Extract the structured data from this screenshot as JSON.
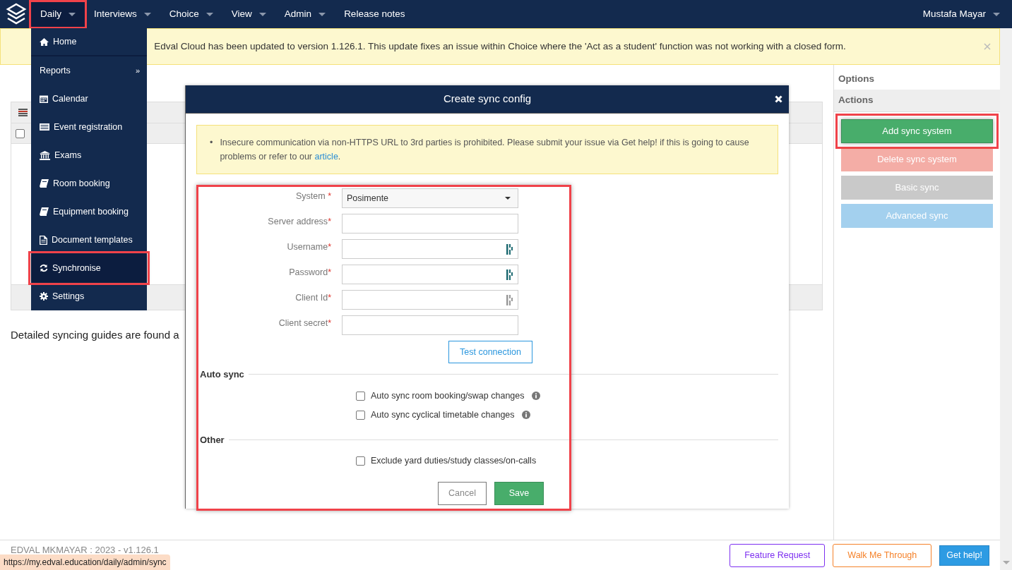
{
  "navbar": {
    "items": [
      {
        "label": "Daily",
        "caret": true,
        "selected": true,
        "highlighted": true
      },
      {
        "label": "Interviews",
        "caret": true,
        "selected": false,
        "highlighted": false
      },
      {
        "label": "Choice",
        "caret": true,
        "selected": false,
        "highlighted": false
      },
      {
        "label": "View",
        "caret": true,
        "selected": false,
        "highlighted": false
      },
      {
        "label": "Admin",
        "caret": true,
        "selected": false,
        "highlighted": false
      },
      {
        "label": "Release notes",
        "caret": false,
        "selected": false,
        "highlighted": false
      }
    ],
    "user": "Mustafa Mayar"
  },
  "banner": {
    "text": "Edval Cloud has been updated to version 1.126.1.  This update fixes an issue within Choice where the 'Act as a student' function was not working with a closed form."
  },
  "daily_menu": {
    "items": [
      {
        "label": "Home",
        "kind": "home",
        "submenu": false,
        "selected": false,
        "highlighted": false
      },
      {
        "label": "Reports",
        "kind": "none",
        "submenu": true,
        "submenu_mark": "»",
        "selected": false,
        "highlighted": false
      },
      {
        "label": "Calendar",
        "kind": "calendar",
        "submenu": false,
        "selected": false,
        "highlighted": false
      },
      {
        "label": "Event registration",
        "kind": "list",
        "submenu": false,
        "selected": false,
        "highlighted": false
      },
      {
        "label": "Exams",
        "kind": "bank",
        "submenu": false,
        "selected": false,
        "highlighted": false
      },
      {
        "label": "Room booking",
        "kind": "book",
        "submenu": false,
        "selected": false,
        "highlighted": false
      },
      {
        "label": "Equipment booking",
        "kind": "book",
        "submenu": false,
        "selected": false,
        "highlighted": false
      },
      {
        "label": "Document templates",
        "kind": "file",
        "submenu": false,
        "selected": false,
        "highlighted": false
      },
      {
        "label": "Synchronise",
        "kind": "sync",
        "submenu": false,
        "selected": true,
        "highlighted": true
      },
      {
        "label": "Settings",
        "kind": "gear",
        "submenu": false,
        "selected": false,
        "highlighted": false
      }
    ]
  },
  "table": {
    "select_all_checked": false
  },
  "guide_text": "Detailed syncing guides are found a",
  "sidebar": {
    "options": "Options",
    "actions": "Actions",
    "buttons": [
      {
        "label": "Add sync system",
        "kind": "success",
        "disabled": false,
        "highlighted": true
      },
      {
        "label": "Delete sync system",
        "kind": "danger",
        "disabled": true,
        "highlighted": false
      },
      {
        "label": "Basic sync",
        "kind": "default",
        "disabled": true,
        "highlighted": false
      },
      {
        "label": "Advanced sync",
        "kind": "info",
        "disabled": true,
        "highlighted": false
      }
    ]
  },
  "modal": {
    "title": "Create sync config",
    "warning": {
      "bullet": "•",
      "before": "Insecure communication via non-HTTPS URL to 3rd parties is prohibited. Please submit your issue via Get help! if this is going to cause problems or refer to our ",
      "link": "article",
      "after": "."
    },
    "form_highlighted": true,
    "fields": [
      {
        "label": "System",
        "required_mark": " *",
        "kind": "select",
        "value": "Posimente",
        "autofill_icon": false
      },
      {
        "label": "Server address",
        "required_mark": "*",
        "kind": "text",
        "autofill_icon": false
      },
      {
        "label": "Username",
        "required_mark": "*",
        "kind": "text",
        "autofill_icon": true,
        "autofill_dimmed": false
      },
      {
        "label": "Password",
        "required_mark": "*",
        "kind": "text",
        "autofill_icon": true,
        "autofill_dimmed": false
      },
      {
        "label": "Client Id",
        "required_mark": "*",
        "kind": "text",
        "autofill_icon": true,
        "autofill_dimmed": true
      },
      {
        "label": "Client secret",
        "required_mark": "*",
        "kind": "text",
        "autofill_icon": false
      }
    ],
    "test_button": "Test connection",
    "sections": [
      {
        "title": "Auto sync",
        "options": [
          {
            "label": "Auto sync room booking/swap changes",
            "checked": false,
            "info": true
          },
          {
            "label": "Auto sync cyclical timetable changes",
            "checked": false,
            "info": true
          }
        ]
      },
      {
        "title": "Other",
        "options": [
          {
            "label": "Exclude yard duties/study classes/on-calls",
            "checked": false,
            "info": false
          }
        ]
      }
    ],
    "cancel": "Cancel",
    "save": "Save"
  },
  "footer": {
    "text": "EDVAL MKMAYAR : 2023 - v1.126.1",
    "buttons": [
      {
        "label": "Feature Request",
        "kind": "purple"
      },
      {
        "label": "Walk Me Through",
        "kind": "orange"
      },
      {
        "label": "Get help!",
        "kind": "solid"
      }
    ]
  },
  "status_url": "https://my.edval.education/daily/admin/sync"
}
